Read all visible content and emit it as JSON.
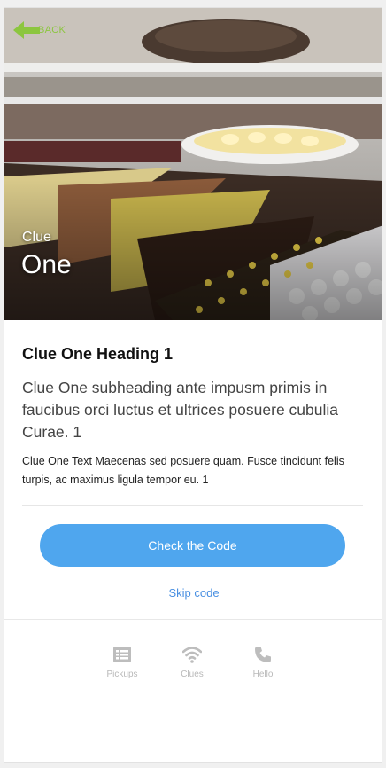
{
  "header": {
    "back_label": "BACK",
    "kicker": "Clue",
    "title": "One"
  },
  "clue": {
    "heading": "Clue One Heading 1",
    "subheading": "Clue One subheading ante impusm primis in faucibus orci luctus et ultrices posuere cubulia Curae. 1",
    "text": "Clue One Text Maecenas sed posuere quam. Fusce tincidunt felis turpis, ac maximus ligula tempor eu. 1"
  },
  "actions": {
    "check_label": "Check the Code",
    "skip_label": "Skip code"
  },
  "tabs": [
    {
      "label": "Pickups",
      "icon": "list-icon"
    },
    {
      "label": "Clues",
      "icon": "wifi-icon"
    },
    {
      "label": "Hello",
      "icon": "phone-icon"
    }
  ],
  "colors": {
    "accent": "#4fa6ee",
    "link": "#4a90e2",
    "back": "#8cc63f",
    "tab_inactive": "#b9b9b9"
  }
}
